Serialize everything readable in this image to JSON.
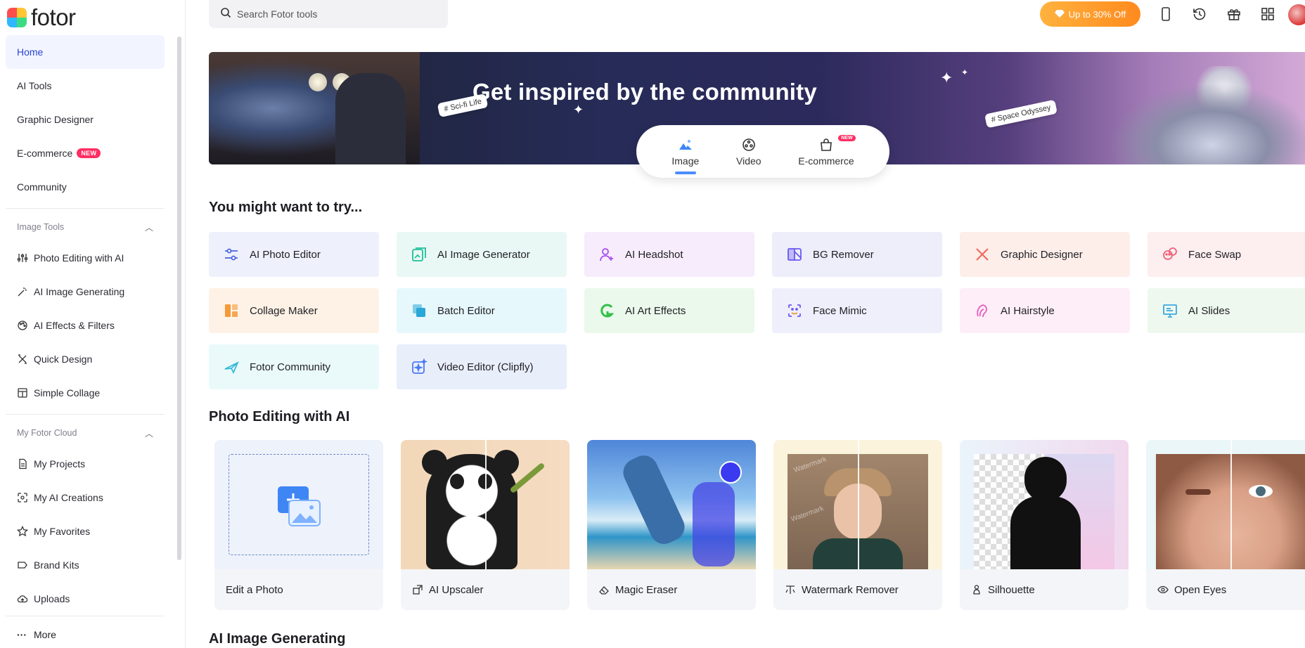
{
  "app": {
    "logo_text": "fotor"
  },
  "sidebar": {
    "main_items": [
      {
        "label": "Home"
      },
      {
        "label": "AI Tools"
      },
      {
        "label": "Graphic Designer"
      },
      {
        "label": "E-commerce",
        "badge": "NEW"
      },
      {
        "label": "Community"
      }
    ],
    "image_tools": {
      "title": "Image Tools",
      "items": [
        {
          "label": "Photo Editing with AI",
          "icon": "sliders-icon"
        },
        {
          "label": "AI Image Generating",
          "icon": "magic-wand-icon"
        },
        {
          "label": "AI Effects & Filters",
          "icon": "palette-icon"
        },
        {
          "label": "Quick Design",
          "icon": "pencil-ruler-icon"
        },
        {
          "label": "Simple Collage",
          "icon": "collage-icon"
        }
      ]
    },
    "cloud": {
      "title": "My Fotor Cloud",
      "items": [
        {
          "label": "My Projects",
          "icon": "document-icon"
        },
        {
          "label": "My AI Creations",
          "icon": "ai-frame-icon"
        },
        {
          "label": "My Favorites",
          "icon": "star-icon"
        },
        {
          "label": "Brand Kits",
          "icon": "tag-icon"
        },
        {
          "label": "Uploads",
          "icon": "cloud-upload-icon"
        }
      ]
    },
    "more_label": "More"
  },
  "topbar": {
    "search_placeholder": "Search Fotor tools",
    "promo_label": "Up to 30% Off"
  },
  "banner": {
    "title": "Get inspired by the community",
    "tag_left": "# Sci-fi Life",
    "tag_right": "# Space Odyssey",
    "tabs": [
      {
        "label": "Image",
        "active": true
      },
      {
        "label": "Video"
      },
      {
        "label": "E-commerce",
        "badge": "NEW"
      }
    ]
  },
  "sections": {
    "try_title": "You might want to try...",
    "photo_editing_title": "Photo Editing with AI",
    "ai_generating_title": "AI Image Generating"
  },
  "tools": [
    {
      "label": "AI Photo Editor",
      "bg": "#eef0fb",
      "icon": "sliders-icon",
      "color": "#4a63e0"
    },
    {
      "label": "AI Image Generator",
      "bg": "#e9f8f4",
      "icon": "image-gen-icon",
      "color": "#1fbf9a"
    },
    {
      "label": "AI Headshot",
      "bg": "#f7ecfb",
      "icon": "person-plus-icon",
      "color": "#a54cf0"
    },
    {
      "label": "BG Remover",
      "bg": "#eeeefb",
      "icon": "bg-remove-icon",
      "color": "#6a5af0"
    },
    {
      "label": "Graphic Designer",
      "bg": "#fdeeea",
      "icon": "pencil-cross-icon",
      "color": "#f06a5a"
    },
    {
      "label": "Face Swap",
      "bg": "#fdeef0",
      "icon": "face-swap-icon",
      "color": "#f0627a"
    },
    {
      "label": "Collage Maker",
      "bg": "#fef2e6",
      "icon": "collage-icon",
      "color": "#f59a3a"
    },
    {
      "label": "Batch Editor",
      "bg": "#e6f8fb",
      "icon": "layers-icon",
      "color": "#2aa7d8"
    },
    {
      "label": "AI Art Effects",
      "bg": "#ebf8ec",
      "icon": "art-g-icon",
      "color": "#35c04a"
    },
    {
      "label": "Face Mimic",
      "bg": "#efeefb",
      "icon": "face-mimic-icon",
      "color": "#6a5af0"
    },
    {
      "label": "AI Hairstyle",
      "bg": "#fdeef7",
      "icon": "hair-icon",
      "color": "#e85ac0"
    },
    {
      "label": "AI Slides",
      "bg": "#eef8ee",
      "icon": "slides-icon",
      "color": "#3aa8e0"
    },
    {
      "label": "Fotor Community",
      "bg": "#eafafa",
      "icon": "plane-icon",
      "color": "#3ab8d8"
    },
    {
      "label": "Video Editor (Clipfly)",
      "bg": "#e9eefb",
      "icon": "video-spark-icon",
      "color": "#4a7af0"
    }
  ],
  "cards": [
    {
      "label": "Edit a Photo"
    },
    {
      "label": "AI Upscaler",
      "icon": "upscale-icon"
    },
    {
      "label": "Magic Eraser",
      "icon": "eraser-icon"
    },
    {
      "label": "Watermark Remover",
      "icon": "watermark-icon"
    },
    {
      "label": "Silhouette",
      "icon": "silhouette-icon"
    },
    {
      "label": "Open Eyes",
      "icon": "eye-icon"
    }
  ]
}
